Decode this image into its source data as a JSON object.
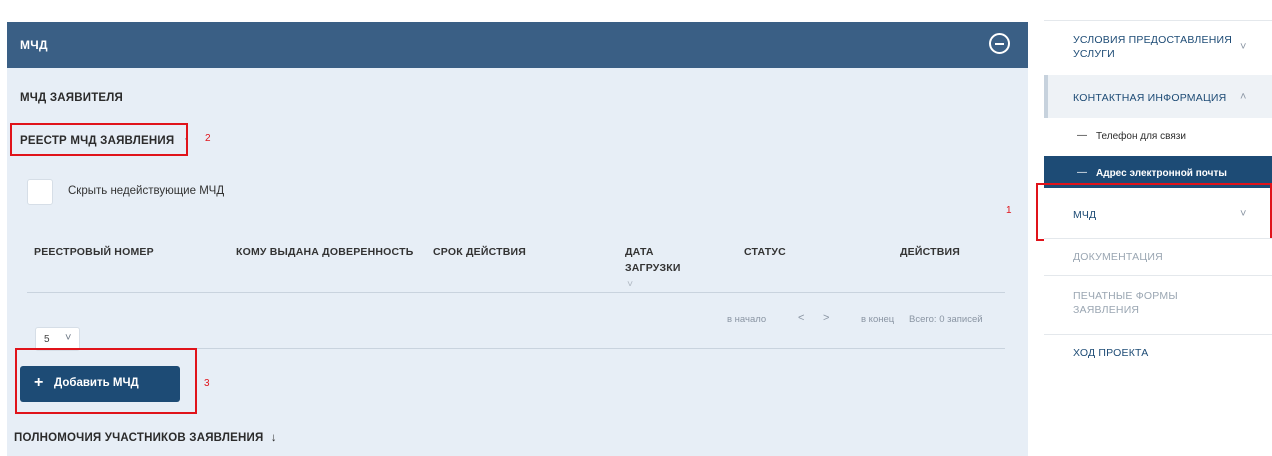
{
  "panel": {
    "title": "МЧД",
    "applicant_section": "МЧД ЗАЯВИТЕЛЯ",
    "registry_section": "РЕЕСТР МЧД ЗАЯВЛЕНИЯ",
    "registry_arrow": "↑",
    "hide_inactive_label": "Скрыть недействующие МЧД",
    "table": {
      "columns": [
        "РЕЕСТРОВЫЙ НОМЕР",
        "КОМУ ВЫДАНА ДОВЕРЕННОСТЬ",
        "СРОК ДЕЙСТВИЯ",
        "ДАТА ЗАГРУЗКИ",
        "СТАТУС",
        "ДЕЙСТВИЯ"
      ],
      "rows": []
    },
    "pagination": {
      "page_size": "5",
      "first": "в начало",
      "prev": "<",
      "next": ">",
      "last": "в конец",
      "total": "Всего: 0 записей"
    },
    "add_button": {
      "icon": "+",
      "label": "Добавить МЧД"
    },
    "powers_section": "ПОЛНОМОЧИЯ УЧАСТНИКОВ ЗАЯВЛЕНИЯ",
    "powers_arrow": "↓"
  },
  "annotations": {
    "one": "1",
    "two": "2",
    "three": "3"
  },
  "sidebar": {
    "items": [
      {
        "label": "УСЛОВИЯ ПРЕДОСТАВЛЕНИЯ УСЛУГИ",
        "chevron": "˅"
      },
      {
        "label": "КОНТАКТНАЯ ИНФОРМАЦИЯ",
        "chevron": "˄"
      },
      {
        "label": "Телефон для связи",
        "dash": "—"
      },
      {
        "label": "Адрес электронной почты",
        "dash": "—"
      },
      {
        "label": "МЧД",
        "chevron": "˅"
      },
      {
        "label": "ДОКУМЕНТАЦИЯ"
      },
      {
        "label": "ПЕЧАТНЫЕ ФОРМЫ ЗАЯВЛЕНИЯ"
      },
      {
        "label": "ХОД ПРОЕКТА"
      }
    ]
  },
  "colors": {
    "header_bg": "#3a5f85",
    "panel_bg": "#e7eef6",
    "primary_button": "#1d4b75",
    "annotation_red": "#e0131a",
    "sidebar_active_bg": "#1d4b75"
  }
}
